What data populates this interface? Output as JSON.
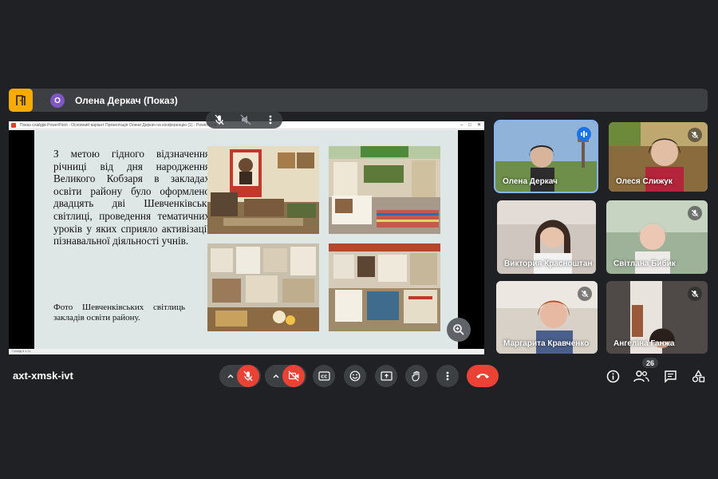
{
  "presenter_bar": {
    "avatar_initial": "О",
    "title": "Олена Деркач (Показ)"
  },
  "shared_window": {
    "window_title": "Показ слайдів PowerPoint - Основний варіант Презентація Олени Деркач на конференцію (1) - PowerPoint",
    "slide_text": "З метою гідного відзначення річниці від дня народження Великого Кобзаря в закладах освіти району було оформлено двадцять дві Шевченківські світлиці, проведення тематичних уроків у яких сприяло активізації пізнавальної діяльності учнів.",
    "slide_caption": "Фото Шевченківських світлиць закладів освіти району.",
    "status_left": "Слайд 6 з 11"
  },
  "participants": [
    {
      "name": "Олена Деркач",
      "state": "speaking"
    },
    {
      "name": "Олеся Слижук",
      "state": "muted"
    },
    {
      "name": "Виктория Красноштан",
      "name_shown": "Виктория Красноштан",
      "state": "muted"
    },
    {
      "name": "Світлана Бибик",
      "state": "muted"
    },
    {
      "name": "Маргарита Кравченко",
      "state": "muted"
    },
    {
      "name": "Ангеліна Ганжа",
      "state": "muted"
    }
  ],
  "controls": {
    "meeting_code": "axt-xmsk-ivt",
    "participant_count": "26"
  },
  "colors": {
    "accent": "#8ab4f8",
    "danger": "#ea4335",
    "surface": "#3c4043",
    "background": "#202124",
    "app_button": "#f9ab00"
  }
}
